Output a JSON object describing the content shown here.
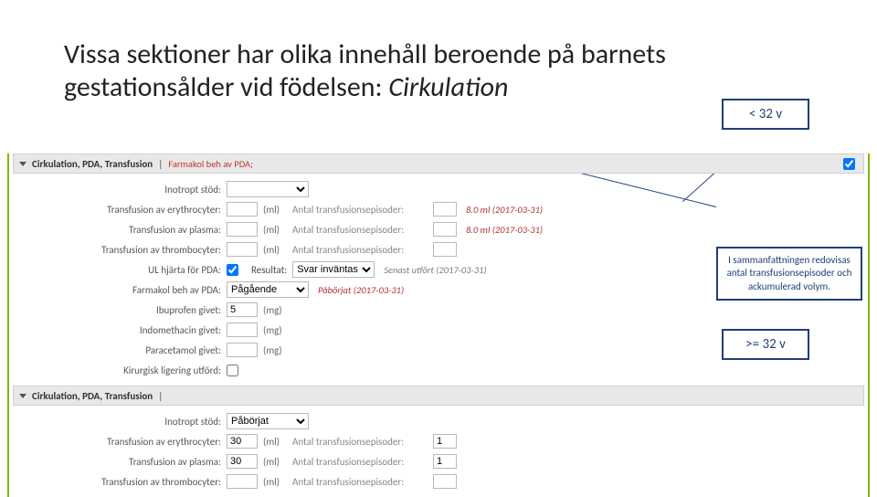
{
  "title_plain": "Vissa sektioner har olika innehåll beroende på barnets gestationsålder vid födelsen: ",
  "title_em": "Cirkulation",
  "callouts": {
    "lt32": "< 32 v",
    "summary": "I sammanfattningen redovisas antal transfusionsepisoder och ackumulerad volym.",
    "ge32": ">= 32 v"
  },
  "panel_title": "Cirkulation, PDA, Transfusion",
  "panel1": {
    "subtitle": "Farmakol beh av PDA;",
    "rows": [
      {
        "label": "Inotropt stöd:",
        "kind": "select",
        "value": ""
      },
      {
        "label": "Transfusion av erythrocyter:",
        "kind": "ml",
        "value": "",
        "aux": "Antal transfusionsepisoder:",
        "auxval": "",
        "stat": "8.0 ml (2017-03-31)",
        "statcls": "redstat"
      },
      {
        "label": "Transfusion av plasma:",
        "kind": "ml",
        "value": "",
        "aux": "Antal transfusionsepisoder:",
        "auxval": "",
        "stat": "8.0 ml (2017-03-31)",
        "statcls": "redstat"
      },
      {
        "label": "Transfusion av thrombocyter:",
        "kind": "ml",
        "value": "",
        "aux": "Antal transfusionsepisoder:",
        "auxval": ""
      },
      {
        "label": "UL hjärta för PDA:",
        "kind": "cbres",
        "cb": true,
        "reslabel": "Resultat:",
        "resval": "Svar inväntas",
        "stat": "Senast utfört (2017-03-31)",
        "statcls": "greystat"
      },
      {
        "label": "Farmakol beh av PDA:",
        "kind": "select",
        "value": "Pågående",
        "stat": "Påbörjat (2017-03-31)",
        "statcls": "redstat"
      },
      {
        "label": "Ibuprofen givet:",
        "kind": "mg",
        "value": "5"
      },
      {
        "label": "Indomethacin givet:",
        "kind": "mg",
        "value": ""
      },
      {
        "label": "Paracetamol givet:",
        "kind": "mg",
        "value": ""
      },
      {
        "label": "Kirurgisk ligering utförd:",
        "kind": "cb",
        "cb": false
      }
    ]
  },
  "panel2": {
    "rows": [
      {
        "label": "Inotropt stöd:",
        "kind": "select",
        "value": "Påbörjat"
      },
      {
        "label": "Transfusion av erythrocyter:",
        "kind": "ml",
        "value": "30",
        "aux": "Antal transfusionsepisoder:",
        "auxval": "1"
      },
      {
        "label": "Transfusion av plasma:",
        "kind": "ml",
        "value": "30",
        "aux": "Antal transfusionsepisoder:",
        "auxval": "1"
      },
      {
        "label": "Transfusion av thrombocyter:",
        "kind": "ml",
        "value": "",
        "aux": "Antal transfusionsepisoder:",
        "auxval": ""
      }
    ]
  },
  "units": {
    "ml": "(ml)",
    "mg": "(mg)"
  }
}
